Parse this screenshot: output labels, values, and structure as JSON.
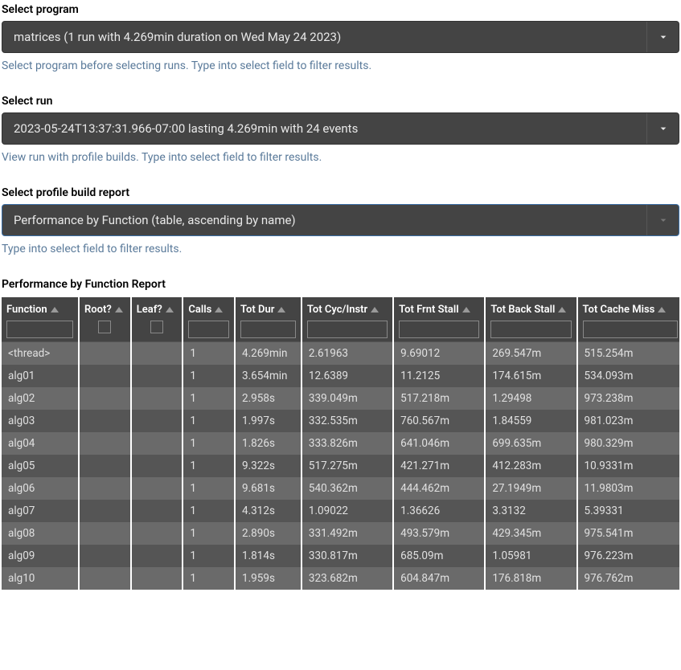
{
  "sections": {
    "program": {
      "label": "Select program",
      "value": "matrices (1 run with 4.269min duration on Wed May 24 2023)",
      "hint": "Select program before selecting runs. Type into select field to filter results."
    },
    "run": {
      "label": "Select run",
      "value": "2023-05-24T13:37:31.966-07:00 lasting 4.269min with 24 events",
      "hint": "View run with profile builds. Type into select field to filter results."
    },
    "report": {
      "label": "Select profile build report",
      "value": "Performance by Function (table, ascending by name)",
      "hint": "Type into select field to filter results."
    }
  },
  "table": {
    "title": "Performance by Function Report",
    "columns": [
      {
        "key": "function",
        "label": "Function",
        "filter": "text"
      },
      {
        "key": "root",
        "label": "Root?",
        "filter": "checkbox"
      },
      {
        "key": "leaf",
        "label": "Leaf?",
        "filter": "checkbox"
      },
      {
        "key": "calls",
        "label": "Calls",
        "filter": "text"
      },
      {
        "key": "totdur",
        "label": "Tot Dur",
        "filter": "text"
      },
      {
        "key": "totcyc",
        "label": "Tot Cyc/Instr",
        "filter": "text"
      },
      {
        "key": "totfrnt",
        "label": "Tot Frnt Stall",
        "filter": "text"
      },
      {
        "key": "totback",
        "label": "Tot Back Stall",
        "filter": "text"
      },
      {
        "key": "totcache",
        "label": "Tot Cache Miss",
        "filter": "text"
      }
    ],
    "rows": [
      {
        "function": "<thread>",
        "root": "",
        "leaf": "",
        "calls": "1",
        "totdur": "4.269min",
        "totcyc": "2.61963",
        "totfrnt": "9.69012",
        "totback": "269.547m",
        "totcache": "515.254m"
      },
      {
        "function": "alg01",
        "root": "",
        "leaf": "",
        "calls": "1",
        "totdur": "3.654min",
        "totcyc": "12.6389",
        "totfrnt": "11.2125",
        "totback": "174.615m",
        "totcache": "534.093m"
      },
      {
        "function": "alg02",
        "root": "",
        "leaf": "",
        "calls": "1",
        "totdur": "2.958s",
        "totcyc": "339.049m",
        "totfrnt": "517.218m",
        "totback": "1.29498",
        "totcache": "973.238m"
      },
      {
        "function": "alg03",
        "root": "",
        "leaf": "",
        "calls": "1",
        "totdur": "1.997s",
        "totcyc": "332.535m",
        "totfrnt": "760.567m",
        "totback": "1.84559",
        "totcache": "981.023m"
      },
      {
        "function": "alg04",
        "root": "",
        "leaf": "",
        "calls": "1",
        "totdur": "1.826s",
        "totcyc": "333.826m",
        "totfrnt": "641.046m",
        "totback": "699.635m",
        "totcache": "980.329m"
      },
      {
        "function": "alg05",
        "root": "",
        "leaf": "",
        "calls": "1",
        "totdur": "9.322s",
        "totcyc": "517.275m",
        "totfrnt": "421.271m",
        "totback": "412.283m",
        "totcache": "10.9331m"
      },
      {
        "function": "alg06",
        "root": "",
        "leaf": "",
        "calls": "1",
        "totdur": "9.681s",
        "totcyc": "540.362m",
        "totfrnt": "444.462m",
        "totback": "27.1949m",
        "totcache": "11.9803m"
      },
      {
        "function": "alg07",
        "root": "",
        "leaf": "",
        "calls": "1",
        "totdur": "4.312s",
        "totcyc": "1.09022",
        "totfrnt": "1.36626",
        "totback": "3.3132",
        "totcache": "5.39331"
      },
      {
        "function": "alg08",
        "root": "",
        "leaf": "",
        "calls": "1",
        "totdur": "2.890s",
        "totcyc": "331.492m",
        "totfrnt": "493.579m",
        "totback": "429.345m",
        "totcache": "975.541m"
      },
      {
        "function": "alg09",
        "root": "",
        "leaf": "",
        "calls": "1",
        "totdur": "1.814s",
        "totcyc": "330.817m",
        "totfrnt": "685.09m",
        "totback": "1.05981",
        "totcache": "976.223m"
      },
      {
        "function": "alg10",
        "root": "",
        "leaf": "",
        "calls": "1",
        "totdur": "1.959s",
        "totcyc": "323.682m",
        "totfrnt": "604.847m",
        "totback": "176.818m",
        "totcache": "976.762m"
      }
    ]
  }
}
